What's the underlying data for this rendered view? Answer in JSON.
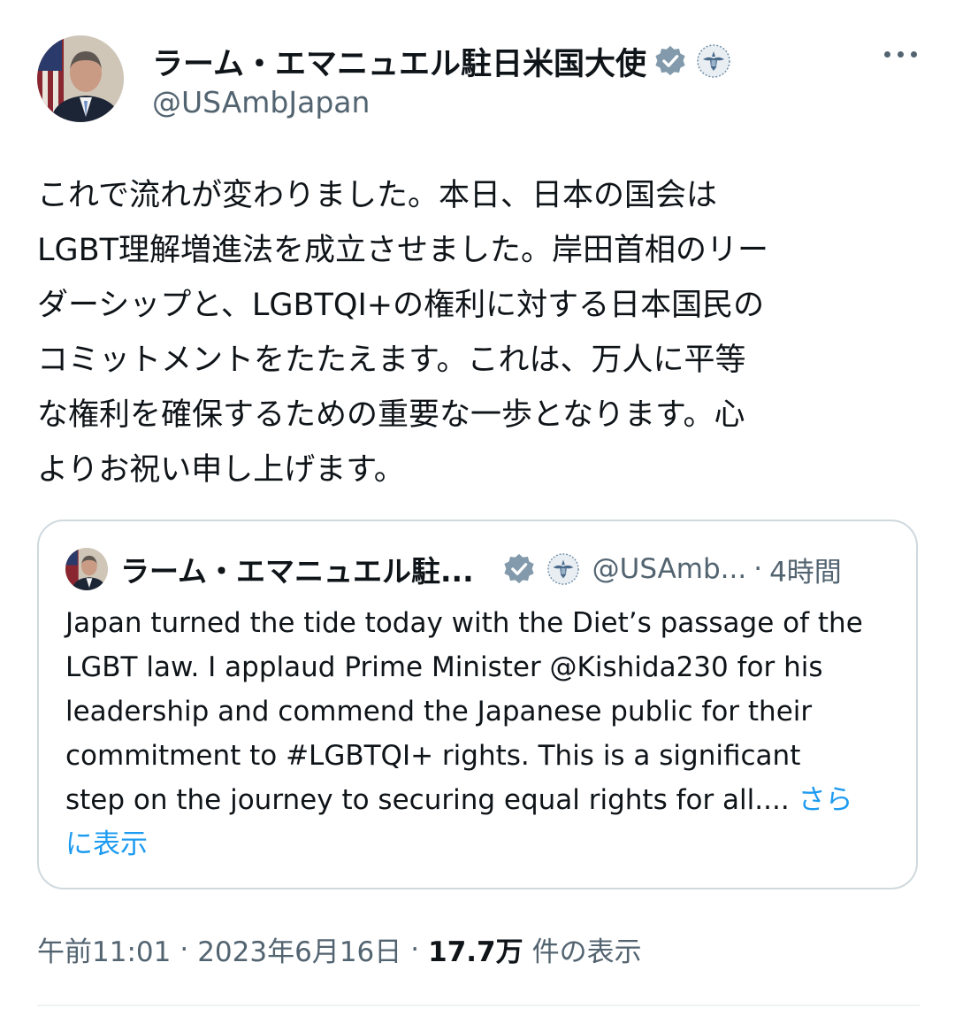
{
  "author": {
    "display_name": "ラーム・エマニュエル駐日米国大使",
    "handle": "@USAmbJapan",
    "verified_badge_icon": "verified-badge-icon",
    "affiliation_icon": "us-state-seal-icon"
  },
  "tweet": {
    "lines": [
      "これで流れが変わりました。本日、日本の国会は",
      "LGBT理解増進法を成立させました。岸田首相のリー",
      "ダーシップと、LGBTQI+の権利に対する日本国民の",
      "コミットメントをたたえます。これは、万人に平等",
      "な権利を確保するための重要な一歩となります。心",
      "よりお祝い申し上げます。"
    ]
  },
  "quote": {
    "display_name": "ラーム・エマニュエル駐...",
    "handle": "@USAmb...",
    "separator": "·",
    "time": "4時間",
    "lines": [
      "Japan turned the tide today with the Diet’s passage of the",
      "LGBT law. I applaud Prime Minister @Kishida230 for his",
      "leadership and commend the Japanese public for their",
      "commitment to #LGBTQI+ rights. This is a significant",
      "step on the journey to securing equal rights for all.... "
    ],
    "show_more_part1": "さら",
    "show_more_part2": "に表示"
  },
  "meta": {
    "time": "午前11:01",
    "separator": "·",
    "date": "2023年6月16日",
    "views_count": "17.7万",
    "views_label": "件の表示"
  },
  "colors": {
    "text": "#0f1419",
    "secondary": "#536471",
    "link": "#1d9bf0",
    "border": "#cfd9de",
    "badge": "#829aab"
  }
}
